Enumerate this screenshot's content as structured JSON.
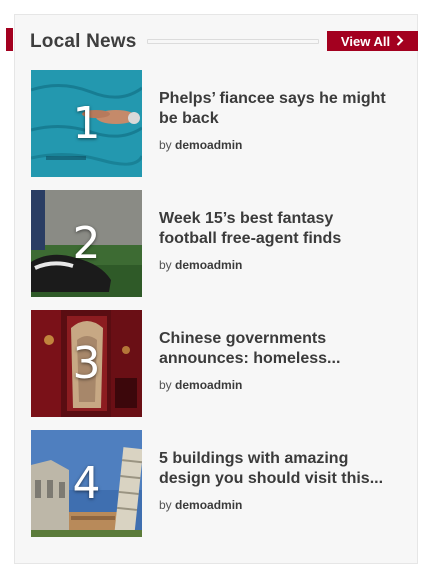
{
  "widget": {
    "title": "Local News",
    "view_all_label": "View All",
    "view_all_icon": "chevron-right-icon",
    "accent_color": "#a3001f"
  },
  "posts": [
    {
      "rank": "1",
      "title_line1": "Phelps’ fiancee says he might",
      "title_line2": "be back",
      "by": "by",
      "author": "demoadmin",
      "image": "swimmer-in-pool"
    },
    {
      "rank": "2",
      "title_line1": "Week 15’s best fantasy",
      "title_line2": "football free-agent finds",
      "by": "by",
      "author": "demoadmin",
      "image": "football-cleat"
    },
    {
      "rank": "3",
      "title_line1": "Chinese governments",
      "title_line2": "announces: homeless...",
      "by": "by",
      "author": "demoadmin",
      "image": "red-cathedral-interior"
    },
    {
      "rank": "4",
      "title_line1": "5 buildings with amazing",
      "title_line2": "design you should visit this...",
      "by": "by",
      "author": "demoadmin",
      "image": "pisa-tower"
    }
  ]
}
